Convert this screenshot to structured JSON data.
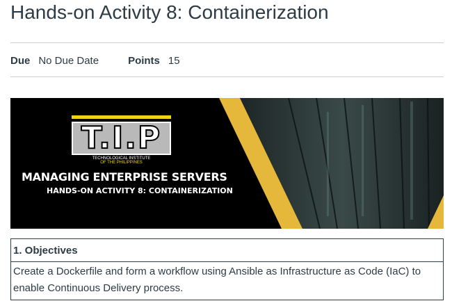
{
  "page": {
    "title": "Hands-on Activity 8: Containerization"
  },
  "details": {
    "due_label": "Due",
    "due_value": "No Due Date",
    "points_label": "Points",
    "points_value": "15"
  },
  "banner": {
    "logo_text": "T.I.P",
    "institute_line1": "TECHNOLOGICAL INSTITUTE",
    "institute_line2": "OF THE PHILIPPINES",
    "title": "MANAGING ENTERPRISE SERVERS",
    "subtitle": "HANDS-ON ACTIVITY 8: CONTAINERIZATION",
    "colors": {
      "accent": "#e5b73b",
      "background": "#000000",
      "server_room": "#2b3a3a"
    }
  },
  "objectives": {
    "heading": "1. Objectives",
    "text": "Create a Dockerfile and form a workflow using Ansible as Infrastructure as Code (IaC) to enable Continuous Delivery process."
  }
}
